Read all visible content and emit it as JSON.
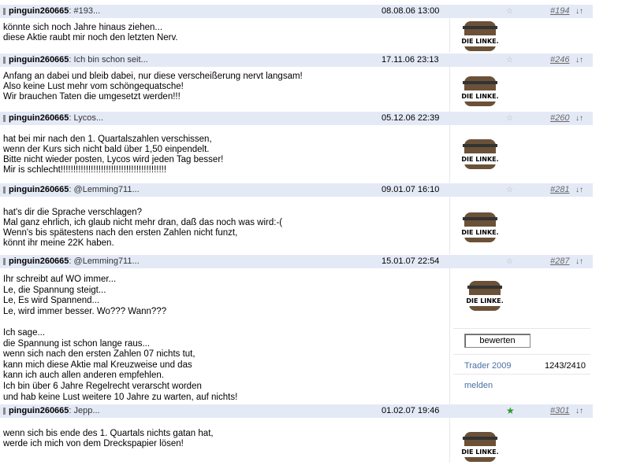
{
  "posts": [
    {
      "author": "pinguin260665",
      "subject": ": #193...",
      "date": "08.08.06 13:00",
      "number": "#194",
      "arrows": "↓↑",
      "star_active": false,
      "body": "könnte sich noch Jahre hinaus ziehen...\ndiese Aktie raubt mir noch den letzten Nerv.",
      "logo_text": "DIE LINKE."
    },
    {
      "author": "pinguin260665",
      "subject": ": Ich bin schon seit...",
      "date": "17.11.06 23:13",
      "number": "#246",
      "arrows": "↓↑",
      "star_active": false,
      "body": "Anfang an dabei und bleib dabei, nur diese verscheißerung nervt langsam!\nAlso keine Lust mehr vom schöngequatsche!\nWir brauchen Taten die umgesetzt werden!!!",
      "logo_text": "DIE LINKE."
    },
    {
      "author": "pinguin260665",
      "subject": ": Lycos...",
      "date": "05.12.06 22:39",
      "number": "#260",
      "arrows": "↓↑",
      "star_active": false,
      "body": "hat bei mir nach den 1. Quartalszahlen verschissen,\nwenn der Kurs sich nicht bald über 1,50 einpendelt.\nBitte nicht wieder posten, Lycos wird jeden Tag besser!\nMir is schlecht!!!!!!!!!!!!!!!!!!!!!!!!!!!!!!!!!!!!!!!!!!",
      "logo_text": "DIE LINKE."
    },
    {
      "author": "pinguin260665",
      "subject": ": @Lemming711...",
      "date": "09.01.07 16:10",
      "number": "#281",
      "arrows": "↓↑",
      "star_active": false,
      "body": "hat's dir die Sprache verschlagen?\nMal ganz ehrlich, ich glaub nicht mehr dran, daß das noch was wird:-(\nWenn's bis spätestens nach den ersten Zahlen nicht funzt,\nkönnt ihr meine 22K haben.",
      "logo_text": "DIE LINKE."
    },
    {
      "author": "pinguin260665",
      "subject": ": @Lemming711...",
      "date": "15.01.07 22:54",
      "number": "#287",
      "arrows": "↓↑",
      "star_active": false,
      "body": "Ihr schreibt auf WO immer...\nLe, die Spannung steigt...\nLe, Es wird Spannend...\nLe, wird immer besser. Wo??? Wann???\n\nIch sage...\ndie Spannung ist schon lange raus...\nwenn sich nach den ersten Zahlen 07 nichts tut,\nkann mich diese Aktie mal Kreuzweise und das\nkann ich auch allen anderen empfehlen.\nIch bin über 6 Jahre Regelrecht verarscht worden\nund hab keine Lust weitere 10 Jahre zu warten, auf nichts!",
      "logo_text": "DIE LINKE.",
      "rate_label": "bewerten",
      "trader_label": "Trader 2009",
      "count": "1243/2410",
      "report_label": "melden"
    },
    {
      "author": "pinguin260665",
      "subject": ": Jepp...",
      "date": "01.02.07 19:46",
      "number": "#301",
      "arrows": "↓↑",
      "star_active": true,
      "body": "wenn sich bis ende des 1. Quartals nichts gatan hat,\nwerde ich mich von dem Dreckspapier lösen!",
      "logo_text": "DIE LINKE."
    }
  ],
  "icons": {
    "star": "☆",
    "star_filled": "★"
  }
}
